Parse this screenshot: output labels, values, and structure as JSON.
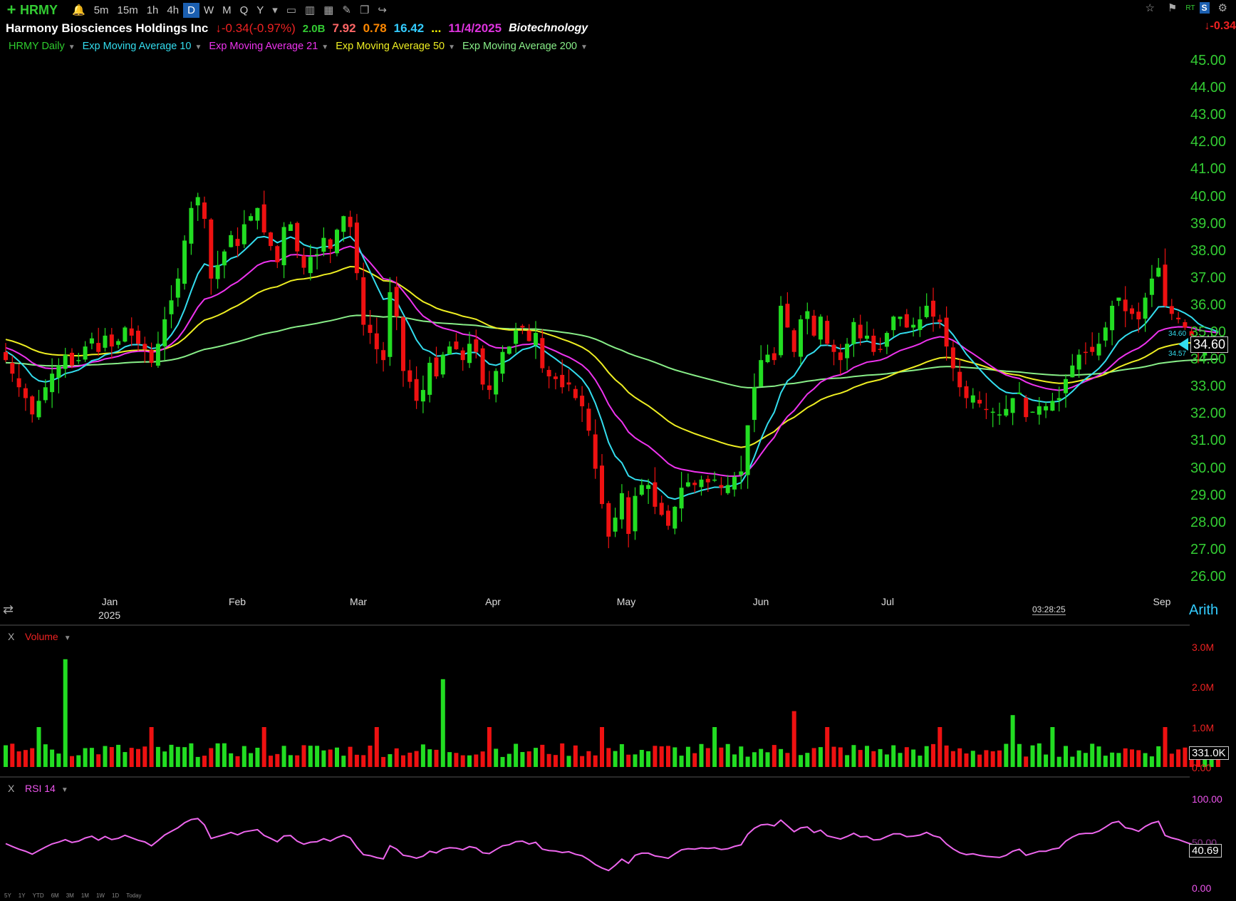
{
  "toolbar": {
    "symbol": "HRMY",
    "timeframes": [
      "5m",
      "15m",
      "1h",
      "4h",
      "D",
      "W",
      "M",
      "Q",
      "Y"
    ],
    "active_timeframe": "D"
  },
  "info": {
    "company": "Harmony Biosciences Holdings Inc",
    "change": "-0.34(-0.97%)",
    "market_cap": "2.0B",
    "pe": "7.92",
    "eps": "0.78",
    "val3": "16.42",
    "dots": "...",
    "earnings_date": "11/4/2025",
    "sector": "Biotechnology",
    "right_change": "-0.34"
  },
  "legend": [
    {
      "label": "HRMY Daily",
      "color": "#2ecc2e"
    },
    {
      "label": "Exp Moving Average 10",
      "color": "#33ddee"
    },
    {
      "label": "Exp Moving Average 21",
      "color": "#ee33ee"
    },
    {
      "label": "Exp Moving Average 50",
      "color": "#eeee22"
    },
    {
      "label": "Exp Moving Average 200",
      "color": "#88ee88"
    }
  ],
  "price_axis": [
    "45.00",
    "44.00",
    "43.00",
    "42.00",
    "41.00",
    "40.00",
    "39.00",
    "38.00",
    "37.00",
    "36.00",
    "35.00",
    "34.00",
    "33.00",
    "32.00",
    "31.00",
    "30.00",
    "29.00",
    "28.00",
    "27.00",
    "26.00"
  ],
  "last_price": "34.60",
  "small_prices": [
    "34.60",
    "34.57"
  ],
  "time_axis": {
    "months": [
      "Jan",
      "Feb",
      "Mar",
      "Apr",
      "May",
      "Jun",
      "Jul",
      "Sep"
    ],
    "year": "2025",
    "clock": "03:28:25",
    "scale": "Arith"
  },
  "volume": {
    "title": "Volume",
    "axis": [
      "3.0M",
      "2.0M",
      "1.0M",
      "0.00"
    ],
    "last": "331.0K"
  },
  "rsi": {
    "title": "RSI 14",
    "axis": [
      "100.00",
      "50.00",
      "0.00"
    ],
    "last": "40.69"
  },
  "pane_close": "X",
  "range_buttons": [
    "5Y",
    "1Y",
    "YTD",
    "6M",
    "3M",
    "1M",
    "1W",
    "1D",
    "Today"
  ],
  "chart_data": {
    "type": "candlestick",
    "ylim": [
      26,
      45
    ],
    "series_names": [
      "HRMY Daily",
      "Exp Moving Average 10",
      "Exp Moving Average 21",
      "Exp Moving Average 50",
      "Exp Moving Average 200"
    ],
    "closes": [
      34.0,
      33.5,
      33.0,
      32.6,
      32.0,
      32.5,
      33.0,
      33.5,
      33.8,
      34.2,
      33.8,
      34.0,
      34.5,
      34.8,
      34.3,
      34.9,
      34.5,
      34.7,
      35.2,
      34.9,
      34.6,
      34.4,
      33.9,
      34.6,
      35.5,
      36.2,
      37.0,
      38.4,
      39.6,
      40.0,
      39.2,
      37.0,
      37.5,
      38.0,
      38.6,
      38.2,
      39.0,
      39.3,
      39.6,
      38.7,
      38.2,
      37.6,
      38.9,
      39.0,
      38.0,
      37.4,
      37.8,
      37.9,
      38.5,
      38.1,
      38.8,
      39.3,
      38.9,
      37.2,
      35.3,
      35.0,
      34.4,
      34.0,
      36.5,
      35.6,
      33.6,
      33.2,
      32.5,
      32.9,
      33.9,
      33.4,
      34.2,
      34.5,
      34.4,
      34.0,
      34.6,
      34.3,
      33.1,
      32.9,
      33.6,
      34.3,
      34.5,
      35.1,
      35.2,
      34.7,
      35.0,
      33.7,
      33.4,
      33.3,
      33.0,
      33.1,
      32.6,
      32.3,
      31.4,
      30.0,
      28.7,
      27.5,
      28.2,
      29.1,
      27.6,
      29.0,
      29.4,
      29.4,
      28.6,
      28.3,
      27.9,
      28.6,
      29.3,
      29.5,
      29.4,
      29.6,
      29.5,
      29.6,
      29.3,
      29.4,
      29.7,
      29.9,
      31.6,
      33.0,
      34.0,
      34.2,
      34.0,
      36.0,
      35.2,
      34.3,
      35.5,
      35.8,
      34.9,
      35.6,
      34.6,
      34.3,
      34.0,
      34.6,
      35.4,
      34.8,
      34.9,
      34.3,
      34.4,
      35.0,
      35.6,
      35.6,
      35.2,
      35.3,
      35.5,
      36.0,
      35.6,
      35.4,
      34.5,
      33.7,
      33.0,
      32.6,
      32.7,
      32.4,
      32.2,
      32.1,
      32.0,
      32.2,
      32.6,
      32.8,
      31.9,
      32.1,
      32.3,
      32.3,
      32.5,
      32.6,
      33.3,
      33.8,
      34.2,
      34.3,
      34.3,
      34.6,
      35.2,
      36.0,
      36.3,
      35.8,
      35.7,
      35.5,
      36.3,
      37.0,
      37.4,
      36.0,
      35.7,
      35.5,
      35.2,
      34.9,
      34.3,
      34.6,
      34.8,
      34.6
    ]
  }
}
